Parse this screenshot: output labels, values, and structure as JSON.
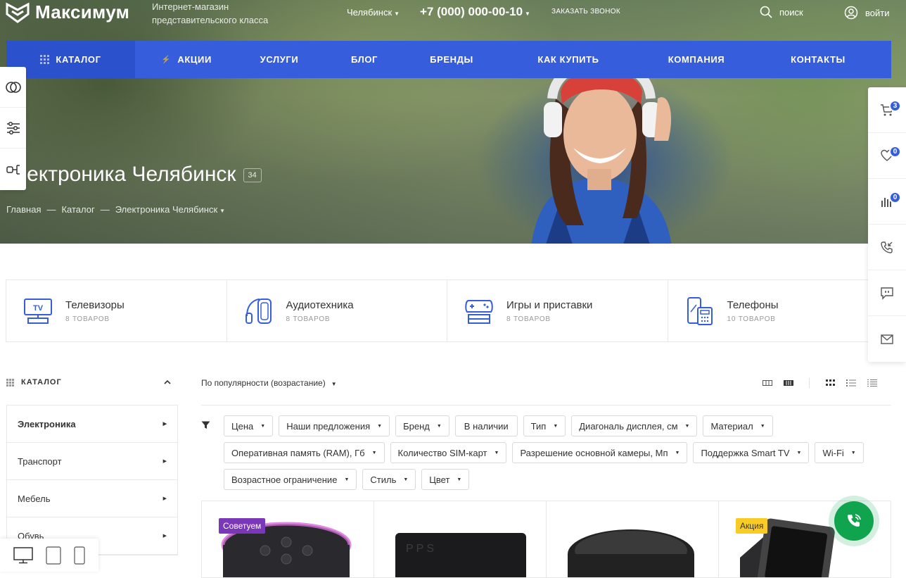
{
  "header": {
    "logo": "Максимум",
    "slogan": "Интернет-магазин представительского класса",
    "city": "Челябинск",
    "phone": "+7 (000) 000-00-10",
    "callback": "ЗАКАЗАТЬ ЗВОНОК",
    "search": "поиск",
    "login": "войти"
  },
  "nav": {
    "items": [
      "КАТАЛОГ",
      "АКЦИИ",
      "УСЛУГИ",
      "БЛОГ",
      "БРЕНДЫ",
      "КАК КУПИТЬ",
      "КОМПАНИЯ",
      "КОНТАКТЫ"
    ]
  },
  "hero": {
    "title": "Электроника Челябинск",
    "count": "34",
    "breadcrumb": [
      "Главная",
      "Каталог",
      "Электроника Челябинск"
    ]
  },
  "right_panel": {
    "cart_count": "3",
    "favorites_count": "0",
    "compare_count": "0"
  },
  "categories": [
    {
      "name": "Телевизоры",
      "count": "8 ТОВАРОВ",
      "icon": "tv-icon"
    },
    {
      "name": "Аудиотехника",
      "count": "8 ТОВАРОВ",
      "icon": "headphones-icon"
    },
    {
      "name": "Игры и приставки",
      "count": "8 ТОВАРОВ",
      "icon": "gamepad-icon"
    },
    {
      "name": "Телефоны",
      "count": "10 ТОВАРОВ",
      "icon": "phone-icon"
    }
  ],
  "sidebar": {
    "title": "КАТАЛОГ",
    "items": [
      "Электроника",
      "Транспорт",
      "Мебель",
      "Обувь"
    ]
  },
  "sort": {
    "label": "По популярности (возрастание)"
  },
  "filters": [
    "Цена",
    "Наши предложения",
    "Бренд",
    "В наличии",
    "Тип",
    "Диагональ дисплея, см",
    "Материал",
    "Оперативная память (RAM), Гб",
    "Количество SIM-карт",
    "Разрешение основной камеры, Мп",
    "Поддержка Smart TV",
    "Wi-Fi",
    "Возрастное ограничение",
    "Стиль",
    "Цвет"
  ],
  "products": [
    {
      "tag": "Советуем"
    },
    {
      "tag": ""
    },
    {
      "tag": ""
    },
    {
      "tag": "Акция"
    }
  ],
  "colors": {
    "nav": "#365edc",
    "nav_active": "#2b51cc",
    "call": "#11a44f",
    "tag_recommend": "#7a37b8",
    "tag_sale": "#f8cc25"
  }
}
